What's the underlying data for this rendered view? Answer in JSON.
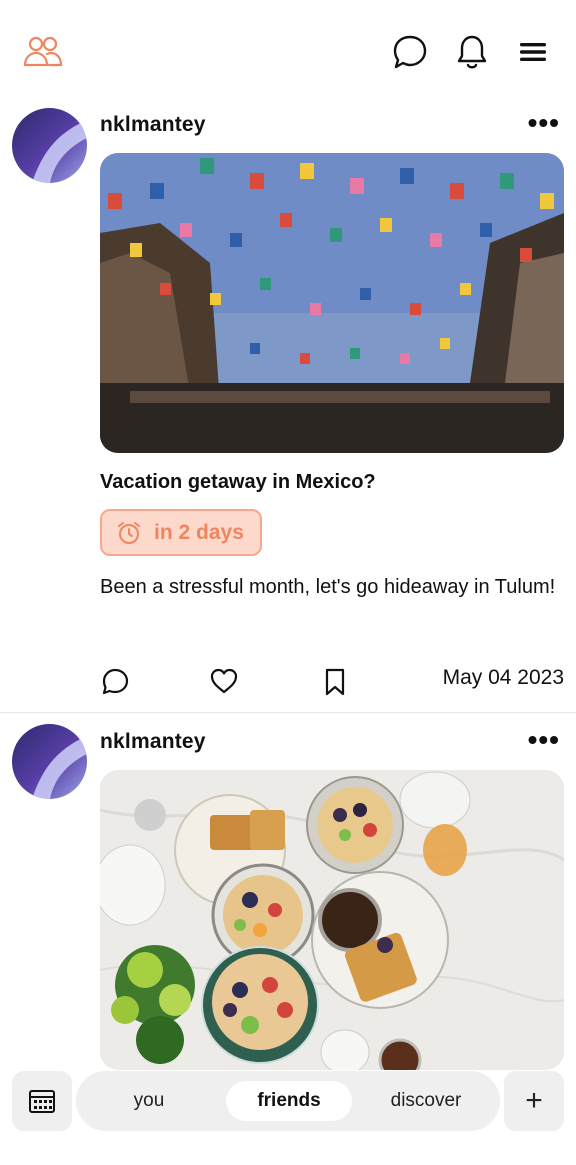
{
  "header": {
    "icons": [
      "friends-icon",
      "chat-icon",
      "bell-icon",
      "menu-icon"
    ]
  },
  "posts": [
    {
      "username": "nklmantey",
      "more": "•••",
      "title": "Vacation getaway in Mexico?",
      "badge": "in 2 days",
      "body": "Been a stressful month, let's go hideaway in Tulum!",
      "date": "May 04 2023"
    },
    {
      "username": "nklmantey",
      "more": "•••"
    }
  ],
  "tabs": {
    "you": "you",
    "friends": "friends",
    "discover": "discover",
    "active": "friends"
  },
  "add_label": "+",
  "colors": {
    "accent": "#f08561",
    "badge_bg": "#fdd9cc",
    "bar_bg": "#efefef"
  }
}
